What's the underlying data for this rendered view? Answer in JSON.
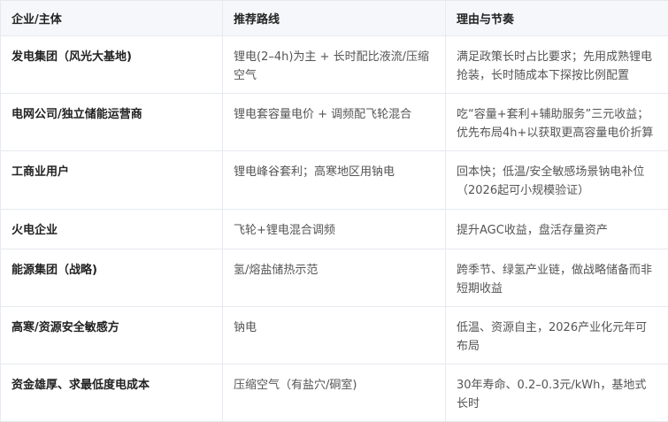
{
  "table": {
    "headers": [
      "企业/主体",
      "推荐路线",
      "理由与节奏"
    ],
    "rows": [
      {
        "subject": "发电集团（风光大基地)",
        "route": "锂电(2–4h)为主 + 长时配比液流/压缩空气",
        "reason": "满足政策长时占比要求；先用成熟锂电抢装，长时随成本下探按比例配置"
      },
      {
        "subject": "电网公司/独立储能运营商",
        "route": "锂电套容量电价 + 调频配飞轮混合",
        "reason": "吃“容量+套利+辅助服务”三元收益；优先布局4h+以获取更高容量电价折算"
      },
      {
        "subject": "工商业用户",
        "route": "锂电峰谷套利；高寒地区用钠电",
        "reason": "回本快；低温/安全敏感场景钠电补位（2026起可小规模验证）"
      },
      {
        "subject": "火电企业",
        "route": "飞轮+锂电混合调频",
        "reason": "提升AGC收益，盘活存量资产"
      },
      {
        "subject": "能源集团（战略)",
        "route": "氢/熔盐储热示范",
        "reason": "跨季节、绿氢产业链，做战略储备而非短期收益"
      },
      {
        "subject": "高寒/资源安全敏感方",
        "route": "钠电",
        "reason": "低温、资源自主，2026产业化元年可布局"
      },
      {
        "subject": "资金雄厚、求最低度电成本",
        "route": "压缩空气（有盐穴/硐室)",
        "reason": "30年寿命、0.2–0.3元/kWh，基地式长时"
      }
    ]
  }
}
